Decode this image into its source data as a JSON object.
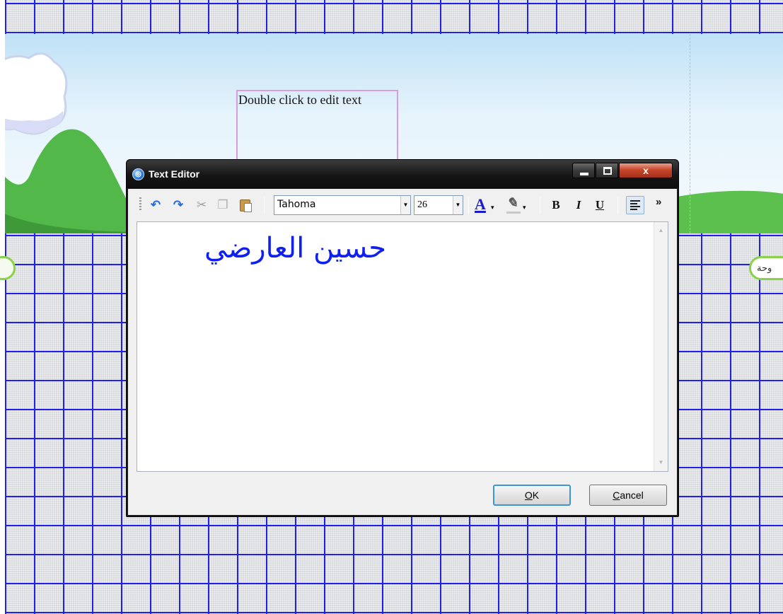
{
  "canvas": {
    "placeholder_text": "Double click to edit text",
    "right_pill_text": "وحة",
    "colors": {
      "grid_line": "#2020e8",
      "pill_border": "#8ad24a",
      "placeholder_border": "#d89be0"
    }
  },
  "dialog": {
    "title": "Text Editor",
    "window_buttons": {
      "close_glyph": "x"
    },
    "toolbar": {
      "font_name": "Tahoma",
      "font_size": "26",
      "font_color_letter": "A",
      "bold_label": "B",
      "italic_label": "I",
      "underline_label": "U",
      "more_label": "»",
      "font_color": "#1a1ad0"
    },
    "editor": {
      "text": "حسين العارضي",
      "text_color": "#0f1ff0"
    },
    "buttons": {
      "ok_mnemonic": "O",
      "ok_rest": "K",
      "cancel_mnemonic": "C",
      "cancel_rest": "ancel"
    }
  }
}
